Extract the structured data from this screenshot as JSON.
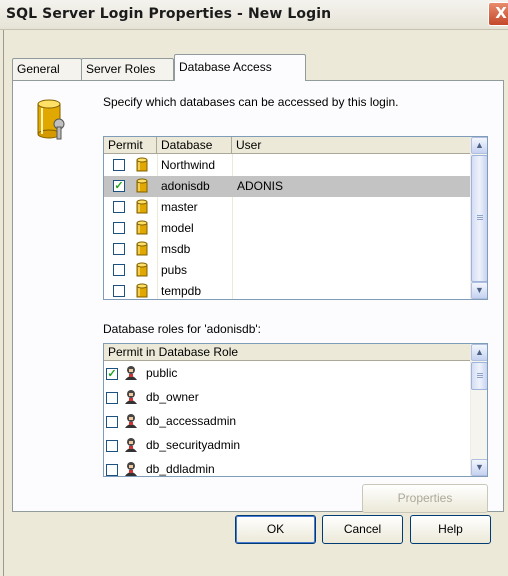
{
  "window": {
    "title": "SQL Server Login Properties - New Login",
    "close_glyph": "X"
  },
  "tabs": [
    {
      "label": "General"
    },
    {
      "label": "Server Roles"
    },
    {
      "label": "Database Access",
      "active": true
    }
  ],
  "description": "Specify which databases can be accessed by this login.",
  "databases": {
    "columns": [
      "Permit",
      "Database",
      "User"
    ],
    "rows": [
      {
        "permit": false,
        "database": "Northwind",
        "user": ""
      },
      {
        "permit": true,
        "database": "adonisdb",
        "user": "ADONIS",
        "selected": true
      },
      {
        "permit": false,
        "database": "master",
        "user": ""
      },
      {
        "permit": false,
        "database": "model",
        "user": ""
      },
      {
        "permit": false,
        "database": "msdb",
        "user": ""
      },
      {
        "permit": false,
        "database": "pubs",
        "user": ""
      },
      {
        "permit": false,
        "database": "tempdb",
        "user": ""
      }
    ]
  },
  "roles": {
    "label": "Database roles for 'adonisdb':",
    "column": "Permit in Database Role",
    "rows": [
      {
        "permit": true,
        "role": "public"
      },
      {
        "permit": false,
        "role": "db_owner"
      },
      {
        "permit": false,
        "role": "db_accessadmin"
      },
      {
        "permit": false,
        "role": "db_securityadmin"
      },
      {
        "permit": false,
        "role": "db_ddladmin"
      }
    ]
  },
  "buttons": {
    "properties": "Properties",
    "ok": "OK",
    "cancel": "Cancel",
    "help": "Help"
  },
  "glyphs": {
    "check": "✓",
    "scroll_up": "▲",
    "scroll_down": "▼"
  },
  "colors": {
    "dialog_bg": "#ece9d8",
    "selected_row": "#c3c3c3",
    "check_green": "#21a121"
  }
}
